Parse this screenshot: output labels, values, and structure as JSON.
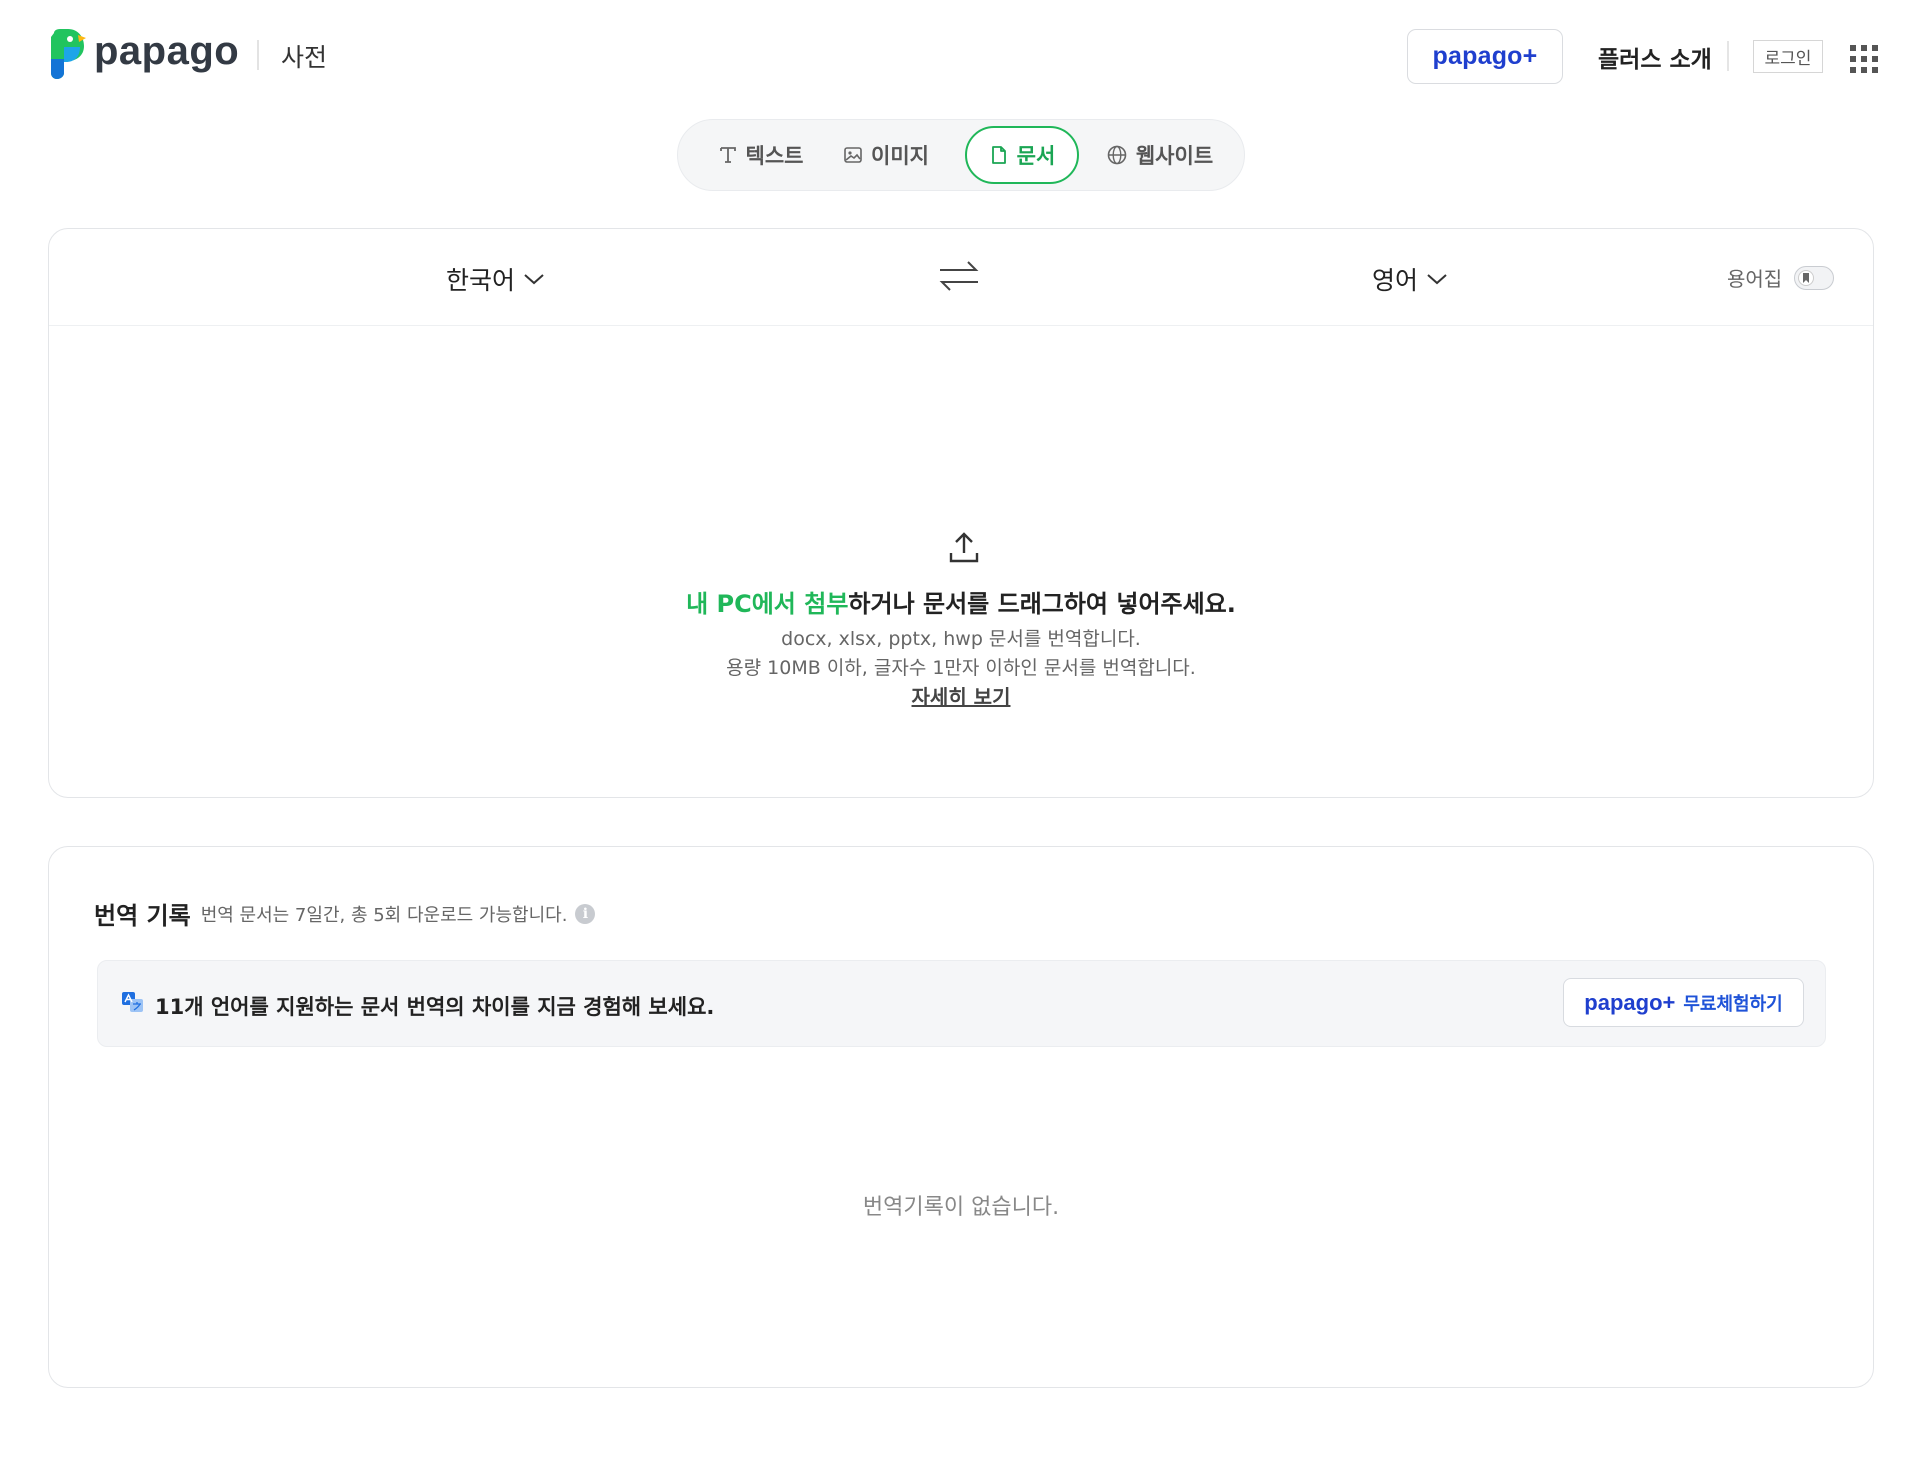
{
  "header": {
    "logo_text": "papago",
    "dict_label": "사전",
    "plus_logo": "papago+",
    "plus_intro": "플러스 소개",
    "login_label": "로그인"
  },
  "tabs": [
    {
      "label": "텍스트",
      "icon": "text-icon",
      "active": false
    },
    {
      "label": "이미지",
      "icon": "image-icon",
      "active": false
    },
    {
      "label": "문서",
      "icon": "document-icon",
      "active": true
    },
    {
      "label": "웹사이트",
      "icon": "globe-icon",
      "active": false
    }
  ],
  "translate": {
    "source_lang": "한국어",
    "target_lang": "영어",
    "glossary_label": "용어집",
    "glossary_enabled": false
  },
  "drop_zone": {
    "link_text": "내 PC에서 첨부",
    "main_rest": "하거나 문서를 드래그하여 넣어주세요.",
    "formats_line": "docx, xlsx, pptx, hwp 문서를 번역합니다.",
    "limits_line": "용량 10MB 이하, 글자수 1만자 이하인 문서를 번역합니다.",
    "detail_link": "자세히 보기"
  },
  "history": {
    "title": "번역 기록",
    "note": "번역 문서는 7일간, 총 5회 다운로드 가능합니다.",
    "promo_text": "11개 언어를 지원하는 문서 번역의 차이를 지금 경험해 보세요.",
    "trial_logo": "papago+",
    "trial_label": "무료체험하기",
    "empty_message": "번역기록이 없습니다."
  },
  "colors": {
    "brand_green": "#20b759",
    "plus_blue": "#1f3fce"
  }
}
